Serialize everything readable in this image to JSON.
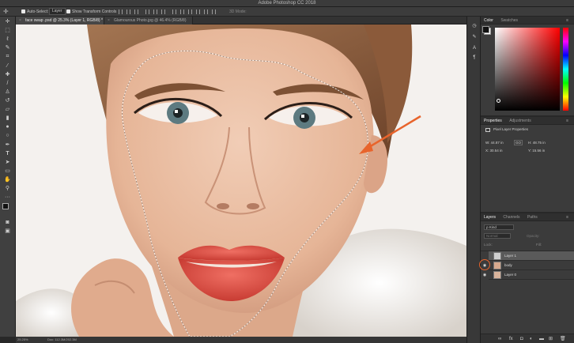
{
  "app": {
    "title": "Adobe Photoshop CC 2018"
  },
  "options": {
    "auto_select_label": "Auto-Select:",
    "auto_select_value": "Layer",
    "transform_label": "Show Transform Controls",
    "mode_label": "3D Mode:"
  },
  "tabs": [
    {
      "label": "face swap .psd @ 25.3% (Layer 1, RGB/8) *"
    },
    {
      "label": "Glamourous Photo.jpg @ 46.4% (RGB/8)"
    }
  ],
  "status": {
    "zoom": "25.25%",
    "doc": "Doc: 112.3M/202.3M"
  },
  "colors": {
    "accent": "#e8642c",
    "canvas_bg": "#f4f1ee"
  },
  "panels": {
    "color": {
      "tabs": [
        "Color",
        "Swatches"
      ]
    },
    "properties": {
      "tabs": [
        "Properties",
        "Adjustments"
      ],
      "type": "Pixel Layer Properties",
      "w": "W:  44.87 in",
      "h": "H:  48.75 in",
      "x": "X:  30.54 in",
      "y": "Y:  15.56 in",
      "link": "GO"
    },
    "layers": {
      "tabs": [
        "Layers",
        "Channels",
        "Paths"
      ],
      "kind": "Kind",
      "mode": "Normal",
      "opacity_label": "Opacity:",
      "lock_label": "Lock:",
      "fill_label": "Fill:",
      "items": [
        {
          "name": "Layer 1"
        },
        {
          "name": "body"
        },
        {
          "name": "Layer 0"
        }
      ]
    }
  }
}
